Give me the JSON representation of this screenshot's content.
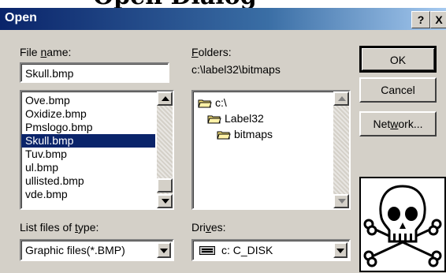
{
  "top_text": "Open Dialog",
  "window": {
    "title": "Open",
    "help_label": "?",
    "close_label": "X"
  },
  "file_name": {
    "label_prefix": "File ",
    "label_accel": "n",
    "label_suffix": "ame:",
    "value": "Skull.bmp"
  },
  "file_list": {
    "items": [
      "Ove.bmp",
      "Oxidize.bmp",
      "Pmslogo.bmp",
      "Skull.bmp",
      "Tuv.bmp",
      "ul.bmp",
      "ullisted.bmp",
      "vde.bmp"
    ],
    "selected": "Skull.bmp"
  },
  "folders": {
    "label_accel": "F",
    "label_suffix": "olders:",
    "path": "c:\\label32\\bitmaps",
    "tree": [
      {
        "label": "c:\\",
        "icon": "folder-open-icon"
      },
      {
        "label": "Label32",
        "icon": "folder-open-icon"
      },
      {
        "label": "bitmaps",
        "icon": "folder-open-icon"
      }
    ]
  },
  "buttons": {
    "ok": "OK",
    "cancel": "Cancel",
    "network_prefix": "Net",
    "network_accel": "w",
    "network_suffix": "ork..."
  },
  "file_type": {
    "label_prefix": "List files of ",
    "label_accel": "t",
    "label_suffix": "ype:",
    "value": "Graphic files(*.BMP)"
  },
  "drives": {
    "label_prefix": "Dri",
    "label_accel": "v",
    "label_suffix": "es:",
    "value": "c: C_DISK",
    "icon": "drive-icon"
  },
  "preview": {
    "icon": "skull-crossbones-icon"
  },
  "colors": {
    "title_start": "#0a246a",
    "title_end": "#a6caf0",
    "selection": "#0a246a",
    "face": "#d4d0c8"
  }
}
